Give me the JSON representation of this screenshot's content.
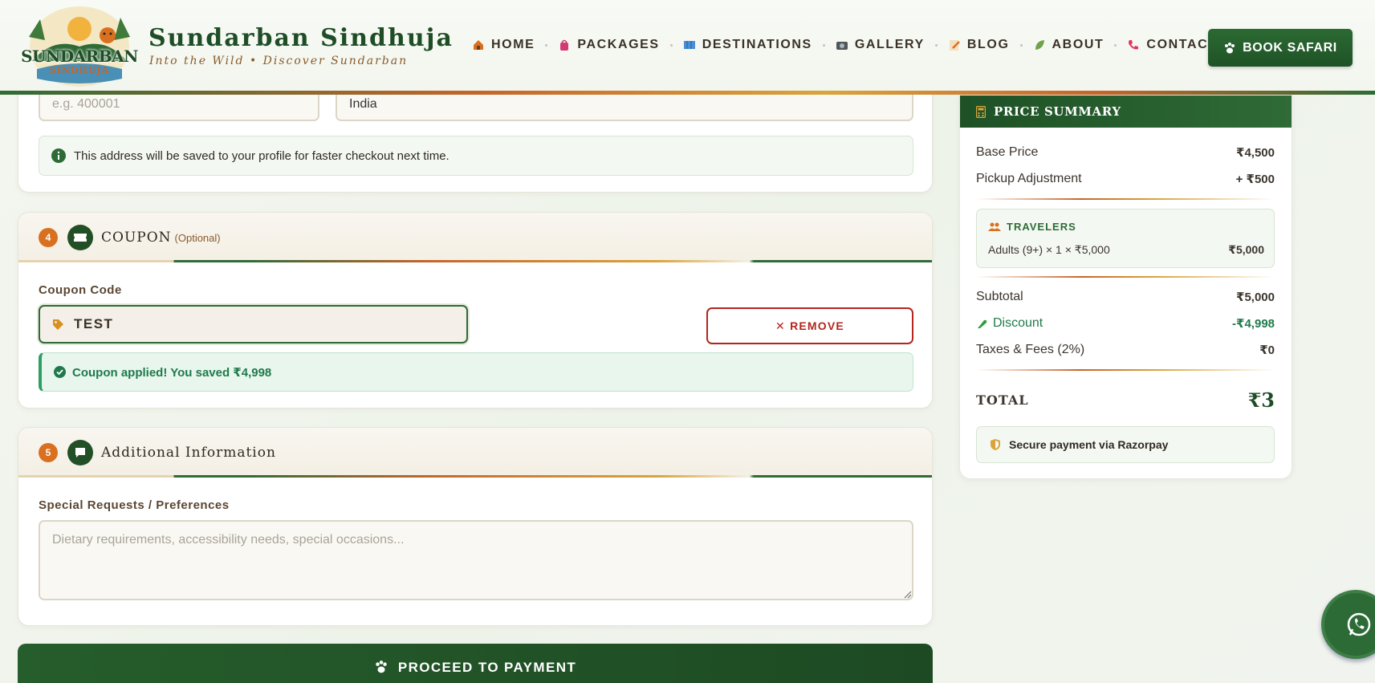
{
  "brand": {
    "badge_line1": "SUNDARBAN",
    "badge_line2": "SINDHUJA",
    "title": "Sundarban Sindhuja",
    "tagline": "Into the Wild  •  Discover Sundarban"
  },
  "nav": {
    "items": [
      {
        "label": "HOME",
        "icon": "house-icon"
      },
      {
        "label": "PACKAGES",
        "icon": "bag-icon"
      },
      {
        "label": "DESTINATIONS",
        "icon": "map-icon"
      },
      {
        "label": "GALLERY",
        "icon": "camera-icon"
      },
      {
        "label": "BLOG",
        "icon": "memo-icon"
      },
      {
        "label": "ABOUT",
        "icon": "leaf-icon"
      },
      {
        "label": "CONTACT",
        "icon": "phone-icon"
      }
    ],
    "book_label": "BOOK SAFARI"
  },
  "address": {
    "pincode_placeholder": "e.g. 400001",
    "country_value": "India",
    "info_text": "This address will be saved to your profile for faster checkout next time."
  },
  "coupon_section": {
    "number": "4",
    "title": "COUPON",
    "optional": "(Optional)",
    "code_label": "Coupon Code",
    "code_value": "TEST",
    "remove_label": "✕ REMOVE",
    "success_text": "Coupon applied! You saved ₹4,998"
  },
  "additional_section": {
    "number": "5",
    "title": "Additional Information",
    "requests_label": "Special Requests / Preferences",
    "requests_placeholder": "Dietary requirements, accessibility needs, special occasions..."
  },
  "proceed_label": "PROCEED TO PAYMENT",
  "summary": {
    "title": "PRICE SUMMARY",
    "base_label": "Base Price",
    "base_value": "₹4,500",
    "pickup_label": "Pickup Adjustment",
    "pickup_value": "+ ₹500",
    "travelers_title": "TRAVELERS",
    "travelers_line": "Adults (9+) × 1 × ₹5,000",
    "travelers_value": "₹5,000",
    "subtotal_label": "Subtotal",
    "subtotal_value": "₹5,000",
    "discount_label": "Discount",
    "discount_value": "-₹4,998",
    "taxes_label": "Taxes & Fees (2%)",
    "taxes_value": "₹0",
    "total_label": "TOTAL",
    "total_value": "₹3",
    "secure_text": "Secure payment via Razorpay"
  },
  "colors": {
    "brand_green": "#1e4d26",
    "accent_orange": "#d9701f",
    "success_green": "#1f7a4a",
    "remove_red": "#b3261e"
  }
}
